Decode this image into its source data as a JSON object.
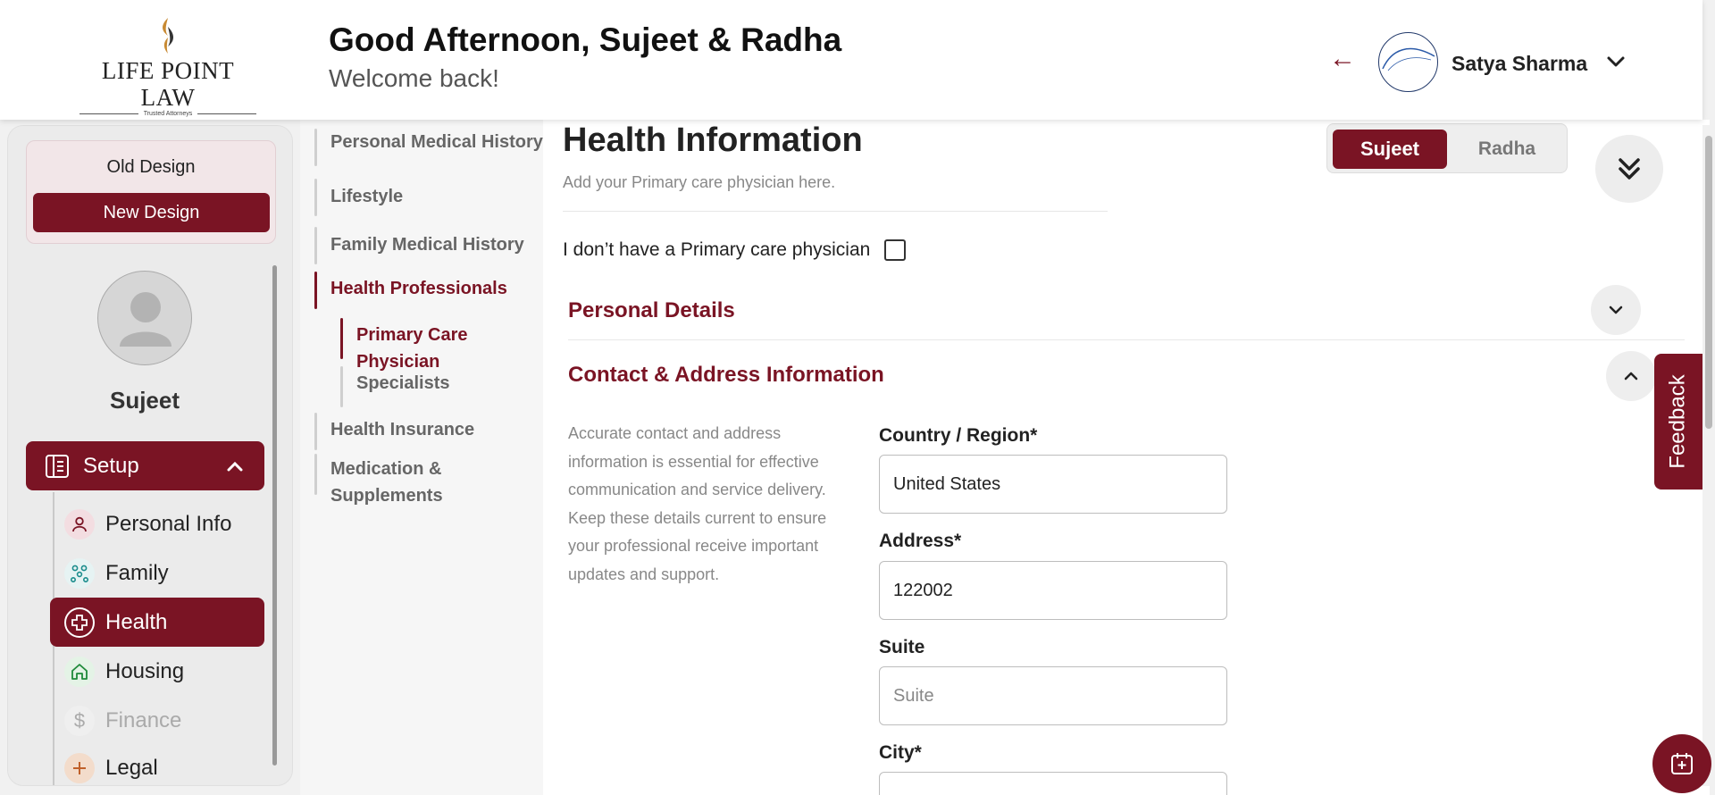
{
  "header": {
    "logo_text": "LIFE POINT LAW",
    "logo_tagline": "Trusted Attorneys",
    "greeting": "Good Afternoon, Sujeet & Radha",
    "welcome": "Welcome back!",
    "user_name": "Satya Sharma"
  },
  "sidebar": {
    "old_design": "Old Design",
    "new_design": "New Design",
    "profile_name": "Sujeet",
    "setup_label": "Setup",
    "items": [
      {
        "label": "Personal Info",
        "icon": "person-icon"
      },
      {
        "label": "Family",
        "icon": "family-icon"
      },
      {
        "label": "Health",
        "icon": "health-cross-icon",
        "active": true
      },
      {
        "label": "Housing",
        "icon": "home-icon"
      },
      {
        "label": "Finance",
        "icon": "dollar-icon",
        "disabled": true
      },
      {
        "label": "Legal",
        "icon": "legal-icon"
      }
    ]
  },
  "subnav": {
    "items": [
      {
        "label": "Personal Medical History"
      },
      {
        "label": "Lifestyle"
      },
      {
        "label": "Family Medical History"
      },
      {
        "label": "Health Professionals",
        "active": true
      },
      {
        "label": "Primary Care Physician",
        "active": true
      },
      {
        "label": "Specialists"
      },
      {
        "label": "Health Insurance"
      },
      {
        "label": "Medication & Supplements"
      }
    ]
  },
  "main": {
    "title": "Health Information",
    "subtitle": "Add your Primary care physician here.",
    "toggle": {
      "option1": "Sujeet",
      "option2": "Radha",
      "selected": "Sujeet"
    },
    "no_physician_label": "I don’t have a Primary care physician",
    "no_physician_checked": false,
    "personal_details_title": "Personal Details",
    "contact_title": "Contact & Address Information",
    "contact_description": "Accurate contact and address information is essential for effective communication and service delivery. Keep these details current to ensure your professional receive important updates and support.",
    "fields": {
      "country_label": "Country / Region*",
      "country_value": "United States",
      "address_label": "Address*",
      "address_value": "122002",
      "suite_label": "Suite",
      "suite_placeholder": "Suite",
      "city_label": "City*"
    }
  },
  "feedback_label": "Feedback",
  "colors": {
    "accent": "#7a1424",
    "background": "#f1f1f1"
  }
}
